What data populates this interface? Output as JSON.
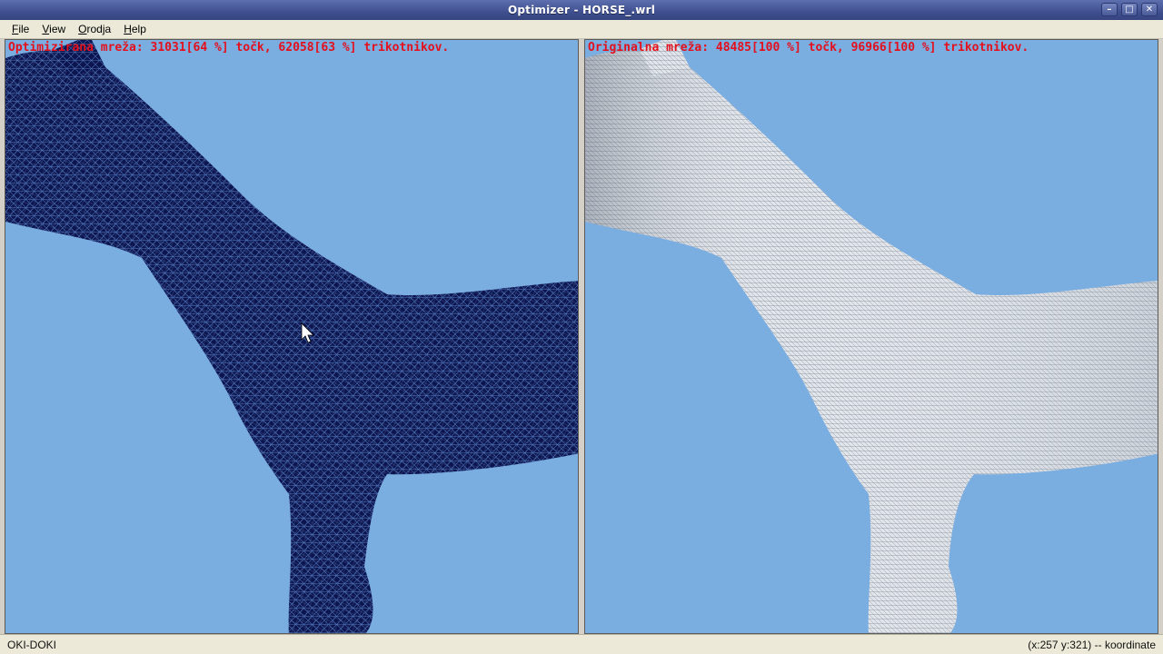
{
  "window": {
    "title": "Optimizer - HORSE_.wrl",
    "controls": [
      "minimize-icon",
      "maximize-icon",
      "close-icon"
    ]
  },
  "menu": {
    "items": [
      {
        "label": "File"
      },
      {
        "label": "View"
      },
      {
        "label": "Orodja"
      },
      {
        "label": "Help"
      }
    ]
  },
  "left_pane": {
    "label": "Optimizirana mreža: 31031[64 %] točk, 62058[63 %] trikotnikov.",
    "mesh_color": "#0d1550",
    "background": "#7aade0"
  },
  "right_pane": {
    "label": "Originalna mreža: 48485[100 %] točk, 96966[100 %] trikotnikov.",
    "mesh_color": "#dfe4ea",
    "background": "#7aade0"
  },
  "status": {
    "left": "OKI-DOKI",
    "right": "(x:257 y:321) -- koordinate"
  },
  "colors": {
    "label_red": "#e4101c",
    "titlebar": "#3f4f8f"
  }
}
